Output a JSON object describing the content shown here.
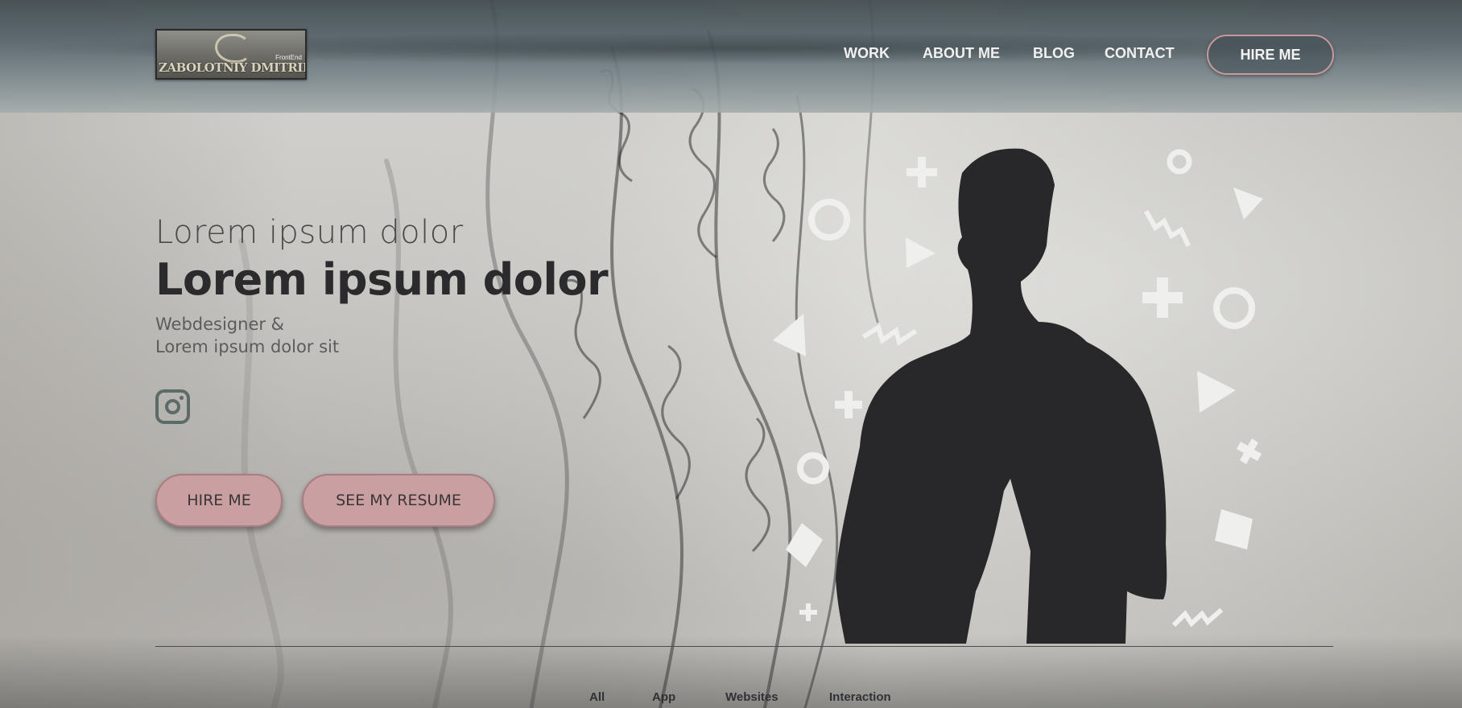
{
  "header": {
    "logo": {
      "text": "ZABOLOTNIY DMITRII",
      "subtext": "FrontEnd"
    },
    "nav": [
      "WORK",
      "ABOUT ME",
      "BLOG",
      "CONTACT"
    ],
    "hire_label": "HIRE ME"
  },
  "hero": {
    "line1": "Lorem ipsum dolor",
    "line2": "Lorem ipsum dolor",
    "subtitle_1": "Webdesigner &",
    "subtitle_2": "Lorem ipsum dolor sit",
    "buttons": {
      "hire": "HIRE ME",
      "resume": "SEE MY RESUME"
    }
  },
  "filters": [
    "All",
    "App",
    "Websites",
    "Interaction"
  ],
  "colors": {
    "accent_pink": "#c99fa2",
    "text_dark": "#2b2b2d",
    "silhouette": "#28282a",
    "icon_teal": "#5d6b68"
  },
  "icons": [
    "instagram-icon",
    "person-silhouette",
    "circle-shape",
    "plus-shape",
    "triangle-shape",
    "zigzag-shape",
    "square-shape"
  ]
}
